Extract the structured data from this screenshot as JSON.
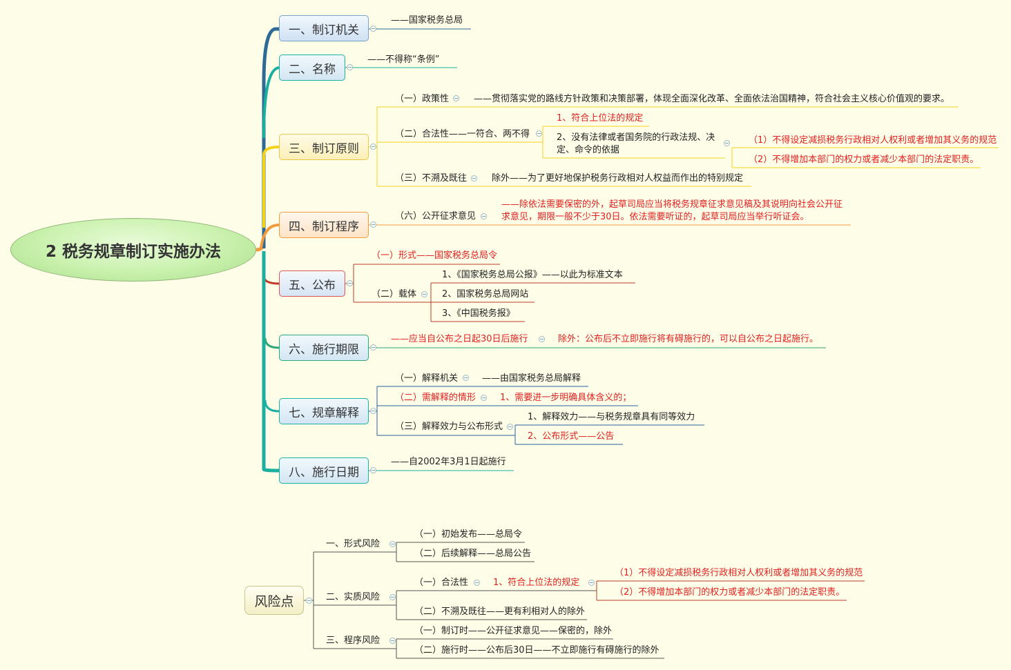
{
  "root": {
    "title": "2  税务规章制订实施办法"
  },
  "branches": [
    {
      "label": "一、制订机关"
    },
    {
      "label": "二、名称"
    },
    {
      "label": "三、制订原则"
    },
    {
      "label": "四、制订程序"
    },
    {
      "label": "五、公布"
    },
    {
      "label": "六、施行期限"
    },
    {
      "label": "七、规章解释"
    },
    {
      "label": "八、施行日期"
    }
  ],
  "b1": {
    "text": "——国家税务总局"
  },
  "b2": {
    "text": "——不得称“条例”"
  },
  "b3": {
    "policy": "（一）政策性",
    "policy_desc": "——贯彻落实党的路线方针政策和决策部署，体现全面深化改革、全面依法治国精神，符合社会主义核心价值观的要求。",
    "legality": "（二）合法性——一符合、两不得",
    "leg1": "1、符合上位法的规定",
    "leg2": "2、没有法律或者国务院的行政法规、决定、命令的依据",
    "leg2a": "（1）不得设定减损税务行政相对人权利或者增加其义务的规范",
    "leg2b": "（2）不得增加本部门的权力或者减少本部门的法定职责。",
    "retro": "（三）不溯及既往",
    "retro_exc": "除外——为了更好地保护税务行政相对人权益而作出的特别规定"
  },
  "b4": {
    "item": "（六）公开征求意见",
    "desc": "——除依法需要保密的外，起草司局应当将税务规章征求意见稿及其说明向社会公开征求意见，期限一般不少于30日。依法需要听证的，起草司局应当举行听证会。"
  },
  "b5": {
    "form": "（一）形式——国家税务总局令",
    "carrier": "（二）载体",
    "c1": "1、《国家税务总局公报》——以此为标准文本",
    "c2": "2、国家税务总局网站",
    "c3": "3、《中国税务报》"
  },
  "b6": {
    "text": "——应当自公布之日起30日后施行",
    "exc": "除外：公布后不立即施行将有碍施行的，可以自公布之日起施行。"
  },
  "b7": {
    "organ": "（一）解释机关",
    "organ_desc": "——由国家税务总局解释",
    "need": "（二）需解释的情形",
    "need_desc": "1、需要进一步明确具体含义的；",
    "effect": "（三）解释效力与公布形式",
    "e1": "1、解释效力——与税务规章具有同等效力",
    "e2": "2、公布形式——公告"
  },
  "b8": {
    "text": "——自2002年3月1日起施行"
  },
  "risk": {
    "title": "风险点",
    "form_risk": "一、形式风险",
    "f1": "（一）初始发布——总局令",
    "f2": "（二）后续解释——总局公告",
    "sub_risk": "二、实质风险",
    "s1": "（一）合法性",
    "s1a": "1、符合上位法的规定",
    "s1a1": "（1）不得设定减损税务行政相对人权利或者增加其义务的规范",
    "s1a2": "（2）不得增加本部门的权力或者减少本部门的法定职责。",
    "s2": "（二）不溯及既往——更有利相对人的除外",
    "proc_risk": "三、程序风险",
    "p1": "（一）制订时——公开征求意见——保密的，除外",
    "p2": "（二）施行时——公布后30日——不立即施行有碍施行的除外"
  },
  "colors": {
    "blue": "#2e6a96",
    "teal": "#19b0a0",
    "yellow": "#f2d21a",
    "orange": "#f39b3c",
    "red": "#c0392b",
    "green": "#2aa879",
    "navy": "#2a5f9e"
  }
}
